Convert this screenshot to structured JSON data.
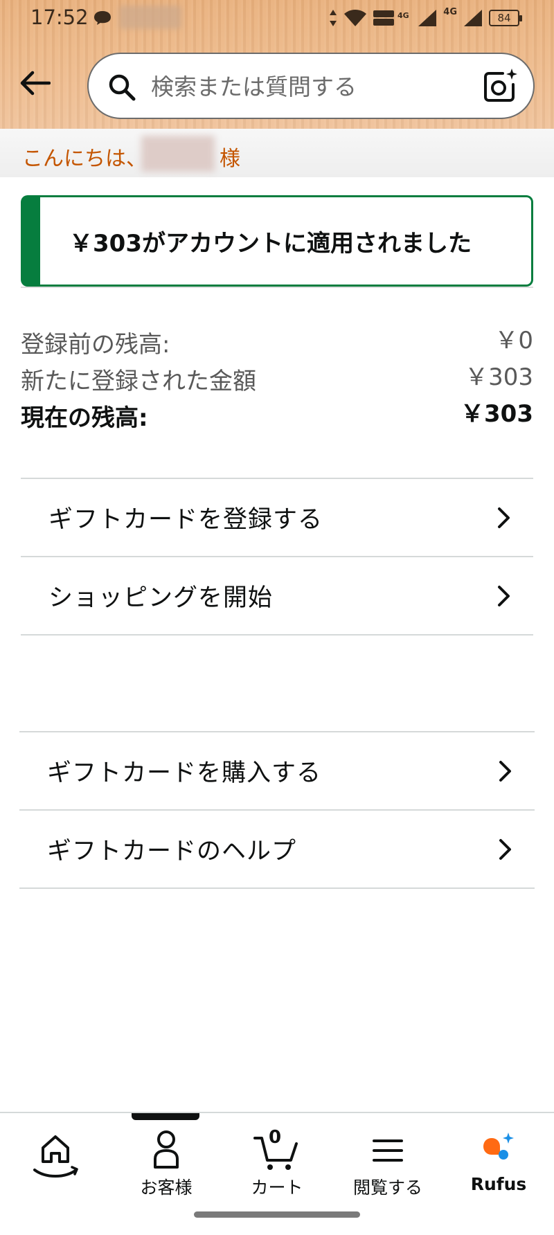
{
  "status_bar": {
    "time": "17:52",
    "network": "4G",
    "battery": "84"
  },
  "search": {
    "placeholder": "検索または質問する"
  },
  "greeting": {
    "text": "こんにちは、　　　　様"
  },
  "alert": {
    "message": "￥303がアカウントに適用されました"
  },
  "balance": {
    "rows": [
      {
        "label": "登録前の残高:",
        "value": "￥0"
      },
      {
        "label": "新たに登録された金額",
        "value": "￥303"
      },
      {
        "label": "現在の残高:",
        "value": "￥303"
      }
    ]
  },
  "menu_primary": [
    {
      "label": "ギフトカードを登録する"
    },
    {
      "label": "ショッピングを開始"
    }
  ],
  "menu_secondary": [
    {
      "label": "ギフトカードを購入する"
    },
    {
      "label": "ギフトカードのヘルプ"
    }
  ],
  "bottom_nav": {
    "account_label": "お客様",
    "cart_label": "カート",
    "cart_count": "0",
    "browse_label": "閲覧する",
    "rufus_label": "Rufus"
  },
  "colors": {
    "accent_green": "#067d3e",
    "greeting_orange": "#c45500",
    "rufus_orange": "#ff6a13",
    "rufus_blue": "#1a8fe6"
  },
  "icons": [
    "back-arrow-icon",
    "search-icon",
    "camera-lens-icon",
    "chevron-right-icon",
    "home-icon",
    "person-icon",
    "cart-icon",
    "menu-icon",
    "rufus-icon"
  ]
}
